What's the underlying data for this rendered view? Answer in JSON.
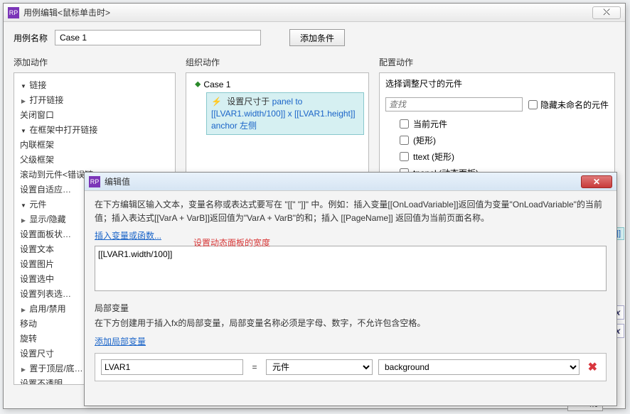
{
  "mainWindow": {
    "title": "用例编辑<鼠标单击时>",
    "closeGlyph": "⤬"
  },
  "caseRow": {
    "label": "用例名称",
    "value": "Case 1",
    "addCondition": "添加条件"
  },
  "columns": {
    "addAction": "添加动作",
    "organize": "组织动作",
    "configure": "配置动作"
  },
  "actionTree": {
    "links": "链接",
    "openLink": "打开链接",
    "closeWindow": "关闭窗口",
    "openInFrame": "在框架中打开链接",
    "innerFrame": "内联框架",
    "parentFrame": "父级框架",
    "scrollTo": "滚动到元件<错误链…",
    "setAdaptive": "设置自适应…",
    "widgets": "元件",
    "showHide": "显示/隐藏",
    "setPanelState": "设置面板状…",
    "setText": "设置文本",
    "setImage": "设置图片",
    "setSelected": "设置选中",
    "setListSel": "设置列表选…",
    "enableDisable": "启用/禁用",
    "move": "移动",
    "rotate": "旋转",
    "setSize": "设置尺寸",
    "bringFront": "置于顶层/底…",
    "setOpacity": "设置不透明…"
  },
  "organize": {
    "caseName": "Case 1",
    "actionLabel": "设置尺寸于",
    "expr": "panel to [[LVAR1.width/100]] x [[LVAR1.height]] anchor 左侧"
  },
  "configure": {
    "heading": "选择调整尺寸的元件",
    "searchPlaceholder": "查找",
    "hideUnnamed": "隐藏未命名的元件",
    "items": [
      "当前元件",
      "(矩形)",
      "ttext (矩形)",
      "tpanel (动态面板)"
    ],
    "strayTag": "eight]]"
  },
  "editWindow": {
    "title": "编辑值",
    "help1": "在下方编辑区输入文本，变量名称或表达式要写在 \"[[\" \"]]\" 中。例如：插入变量[[OnLoadVariable]]返回值为变量\"OnLoadVariable\"的当前值；插入表达式[[VarA + VarB]]返回值为\"VarA + VarB\"的和；插入 [[PageName]] 返回值为当前页面名称。",
    "insertVarLink": "插入变量或函数...",
    "expression": "[[LVAR1.width/100]]",
    "localVarTitle": "局部变量",
    "localVarHelp": "在下方创建用于插入fx的局部变量，局部变量名称必须是字母、数字，不允许包含空格。",
    "addLocalVarLink": "添加局部变量",
    "varName": "LVAR1",
    "eq": "=",
    "varType": "元件",
    "varTarget": "background"
  },
  "overlay": {
    "redAnnotation": "设置动态面板的宽度"
  },
  "fxLabel": "fx",
  "bottomBtn": "消"
}
